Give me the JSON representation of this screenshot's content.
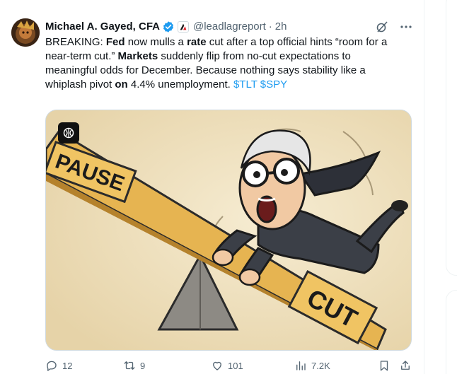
{
  "tweet": {
    "author_name": "Michael A. Gayed, CFA",
    "handle": "@leadlagreport",
    "separator": "·",
    "time": "2h",
    "text_parts": [
      "BREAKING: ",
      "Fed",
      " now mulls a ",
      "rate",
      " cut after a top official hints “room for a near-term cut.” ",
      "Markets",
      " suddenly flip from no-cut expectations to meaningful odds for December. Because nothing says stability like a whiplash pivot ",
      "on",
      " 4.4% unemployment. ",
      "$TLT",
      " ",
      "$SPY"
    ],
    "media": {
      "label_pause": "PAUSE",
      "label_cut": "CUT"
    }
  },
  "actions": {
    "replies": "12",
    "retweets": "9",
    "likes": "101",
    "views": "7.2K"
  },
  "colors": {
    "accent": "#1d9bf0",
    "muted": "#536471",
    "border": "#cfd9de"
  }
}
